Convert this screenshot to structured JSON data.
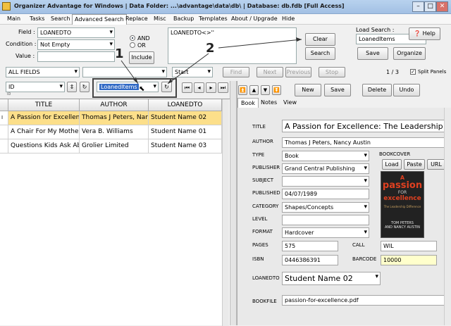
{
  "window": {
    "title": "Organizer Advantage for Windows | Data Folder: ...\\advantage\\data\\db\\ | Database: db.fdb [Full Access]",
    "minimize": "–",
    "maximize": "□",
    "close": "✕"
  },
  "menu": {
    "items": [
      "Main",
      "Tasks",
      "Search",
      "Advanced Search",
      "Replace",
      "Misc",
      "Backup",
      "Templates",
      "About / Upgrade",
      "Hide"
    ]
  },
  "search": {
    "field_label": "Field :",
    "field_value": "LOANEDTO",
    "condition_label": "Condition :",
    "condition_value": "Not Empty",
    "value_label": "Value :",
    "value_value": "",
    "and_label": "AND",
    "or_label": "OR",
    "include_label": "Include",
    "expression": "LOANEDTO<>''",
    "clear_label": "Clear",
    "search_label": "Search",
    "load_search_label": "Load Search :",
    "load_search_value": "LoanedItems",
    "save_label": "Save",
    "organize_label": "Organize",
    "help_label": "Help"
  },
  "filter_bar": {
    "fields_value": "ALL FIELDS",
    "second_value": "",
    "start_value": "Start",
    "find_label": "Find",
    "next_label": "Next",
    "previous_label": "Previous",
    "stop_label": "Stop",
    "record_counter": "1 / 3",
    "split_panels_label": "Split Panels"
  },
  "sort_bar": {
    "sort_field": "ID",
    "sort_sub": "ID",
    "saved_search": "LoanedItems"
  },
  "annotations": {
    "one": "1",
    "two": "2"
  },
  "grid": {
    "columns": [
      "TITLE",
      "AUTHOR",
      "LOANEDTO"
    ],
    "rows": [
      {
        "indicator": "I",
        "title": "A Passion for Excellence: The Leadership",
        "author": "Thomas J Peters, Nancy Austin",
        "loanedto": "Student Name 02"
      },
      {
        "indicator": "",
        "title": "A Chair For My Mother",
        "author": "Vera B. Williams",
        "loanedto": "Student Name 01"
      },
      {
        "indicator": "",
        "title": "Questions Kids Ask About",
        "author": "Grolier Limited",
        "loanedto": "Student Name 03"
      }
    ]
  },
  "record_toolbar": {
    "new_label": "New",
    "save_label": "Save",
    "delete_label": "Delete",
    "undo_label": "Undo"
  },
  "tabs": [
    "Book",
    "Notes",
    "View"
  ],
  "record": {
    "title_label": "TITLE",
    "title": "A Passion for Excellence: The Leadership",
    "author_label": "AUTHOR",
    "author": "Thomas J Peters, Nancy Austin",
    "type_label": "TYPE",
    "type": "Book",
    "publisher_label": "PUBLISHER",
    "publisher": "Grand Central Publishing",
    "subject_label": "SUBJECT",
    "subject": "",
    "published_label": "PUBLISHED",
    "published": "04/07/1989",
    "category_label": "CATEGORY",
    "category": "Shapes/Concepts",
    "level_label": "LEVEL",
    "level": "",
    "format_label": "FORMAT",
    "format": "Hardcover",
    "pages_label": "PAGES",
    "pages": "575",
    "call_label": "CALL",
    "call": "WIL",
    "isbn_label": "ISBN",
    "isbn": "0446386391",
    "barcode_label": "BARCODE",
    "barcode": "10000",
    "loanedto_label": "LOANEDTO",
    "loanedto": "Student Name 02",
    "bookfile_label": "BOOKFILE",
    "bookfile": "passion-for-excellence.pdf",
    "bookcover_label": "BOOKCOVER",
    "load_label": "Load",
    "paste_label": "Paste",
    "url_label": "URL"
  },
  "cover": {
    "line1": "A",
    "line2": "passion",
    "line3": "FOR",
    "line4": "excellence",
    "line5": "The Leadership Difference",
    "line6": "TOM PETERS",
    "line7": "AND NANCY AUSTIN"
  },
  "colors": {
    "selection": "#fcdf8a",
    "barcode_bg": "#ffffcc",
    "highlight": "#316ac5",
    "cover_bg": "#222222",
    "cover_text": "#e04020"
  }
}
